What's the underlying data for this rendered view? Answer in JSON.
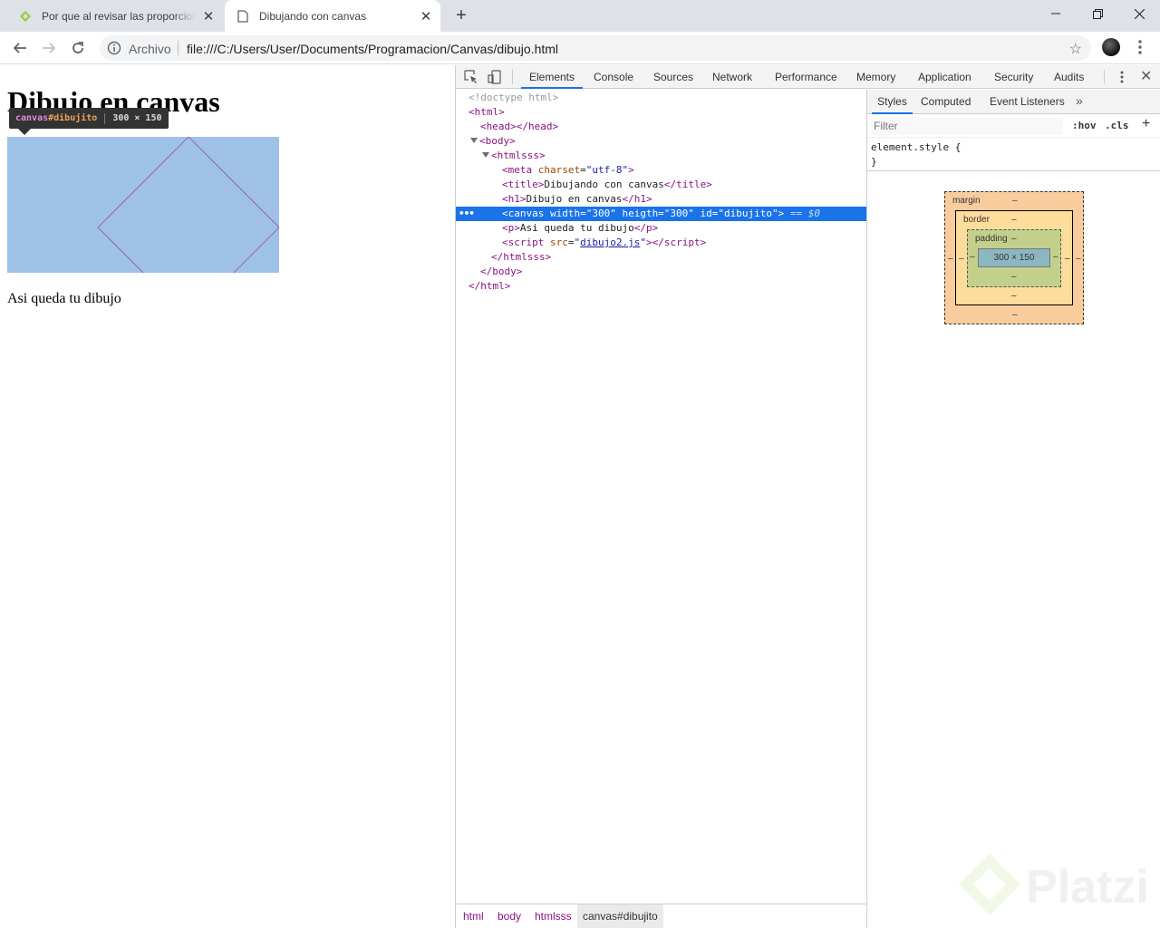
{
  "tabs": [
    {
      "title": "Por que al revisar las proporciones",
      "active": false
    },
    {
      "title": "Dibujando con canvas",
      "active": true
    }
  ],
  "toolbar": {
    "security_label": "Archivo",
    "url": "file:///C:/Users/User/Documents/Programacion/Canvas/dibujo.html"
  },
  "page": {
    "heading": "Dibujo en canvas",
    "paragraph": "Asi queda tu dibujo",
    "canvas_tooltip": {
      "tag": "canvas",
      "id": "#dibujito",
      "size": "300 × 150"
    },
    "canvas_fill": "#9fc1e6",
    "line_color": "#8a50b8"
  },
  "devtools": {
    "tabs": [
      "Elements",
      "Console",
      "Sources",
      "Network",
      "Performance",
      "Memory",
      "Application",
      "Security",
      "Audits"
    ],
    "active_tab": "Elements",
    "dom": {
      "doctype": "<!doctype html>",
      "html_open": "html",
      "head": "head",
      "body": "body",
      "htmlsss": "htmlsss",
      "meta": {
        "tag": "meta",
        "attr": "charset",
        "value": "\"utf-8\""
      },
      "title": {
        "tag": "title",
        "text": "Dibujando con canvas"
      },
      "h1": {
        "tag": "h1",
        "text": "Dibujo en canvas"
      },
      "canvas": {
        "text": "<canvas width=\"300\" heigth=\"300\" id=\"dibujito\">",
        "eq": "== $0"
      },
      "p": {
        "tag": "p",
        "text": "Asi queda tu dibujo"
      },
      "script": {
        "tag": "script",
        "attr": "src",
        "value": "dibujo2.js"
      }
    },
    "breadcrumbs": [
      "html",
      "body",
      "htmlsss",
      "canvas#dibujito"
    ],
    "side_tabs": [
      "Styles",
      "Computed",
      "Event Listeners"
    ],
    "filter_placeholder": "Filter",
    "hov": ":hov",
    "cls": ".cls",
    "element_style": "element.style {\n}",
    "box_model": {
      "margin_label": "margin",
      "border_label": "border",
      "padding_label": "padding",
      "content": "300 × 150",
      "dash": "–"
    }
  }
}
